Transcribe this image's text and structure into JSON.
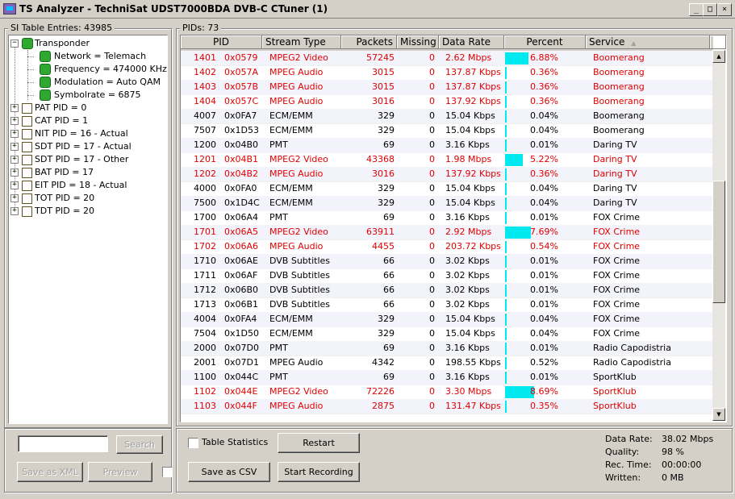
{
  "window": {
    "title": "TS Analyzer - TechniSat UDST7000BDA DVB-C CTuner (1)",
    "buttons": {
      "minimize": "_",
      "maximize": "□",
      "close": "×"
    }
  },
  "si_panel": {
    "label": "SI Table Entries: 43985",
    "tree": [
      {
        "label": "Transponder",
        "icon": "green-dot-icon",
        "level": 0,
        "expander": "−"
      },
      {
        "label": "Network = Telemach",
        "icon": "green-dot-icon",
        "level": 1,
        "expander": ""
      },
      {
        "label": "Frequency = 474000 KHz",
        "icon": "green-dot-icon",
        "level": 1,
        "expander": ""
      },
      {
        "label": "Modulation = Auto QAM",
        "icon": "green-dot-icon",
        "level": 1,
        "expander": ""
      },
      {
        "label": "Symbolrate = 6875",
        "icon": "green-dot-icon",
        "level": 1,
        "expander": ""
      },
      {
        "label": "PAT PID = 0",
        "icon": "table-icon",
        "level": 0,
        "expander": "+"
      },
      {
        "label": "CAT PID = 1",
        "icon": "table-icon",
        "level": 0,
        "expander": "+"
      },
      {
        "label": "NIT PID = 16 - Actual",
        "icon": "table-icon",
        "level": 0,
        "expander": "+"
      },
      {
        "label": "SDT PID = 17 - Actual",
        "icon": "table-icon",
        "level": 0,
        "expander": "+"
      },
      {
        "label": "SDT PID = 17 - Other",
        "icon": "table-icon",
        "level": 0,
        "expander": "+"
      },
      {
        "label": "BAT PID = 17",
        "icon": "table-icon",
        "level": 0,
        "expander": "+"
      },
      {
        "label": "EIT PID = 18 - Actual",
        "icon": "table-icon",
        "level": 0,
        "expander": "+"
      },
      {
        "label": "TOT PID = 20",
        "icon": "table-icon",
        "level": 0,
        "expander": "+"
      },
      {
        "label": "TDT PID = 20",
        "icon": "table-icon",
        "level": 0,
        "expander": "+"
      }
    ],
    "search_input": {
      "value": "",
      "placeholder": ""
    },
    "search_button": "Search",
    "save_xml_button": "Save as XML",
    "preview_button": "Preview"
  },
  "pid_panel": {
    "label": "PIDs: 73",
    "columns": [
      "PID",
      "Stream Type",
      "Packets",
      "Missing",
      "Data Rate",
      "Percent",
      "Service"
    ],
    "sort_indicator": "▲",
    "rows": [
      {
        "pid": "1401",
        "hex": "0x0579",
        "type": "MPEG2 Video",
        "packets": "57245",
        "missing": "0",
        "rate": "2.62 Mbps",
        "percent": "6.88%",
        "pct": 6.88,
        "service": "Boomerang",
        "red": true
      },
      {
        "pid": "1402",
        "hex": "0x057A",
        "type": "MPEG Audio",
        "packets": "3015",
        "missing": "0",
        "rate": "137.87 Kbps",
        "percent": "0.36%",
        "pct": 0.36,
        "service": "Boomerang",
        "red": true
      },
      {
        "pid": "1403",
        "hex": "0x057B",
        "type": "MPEG Audio",
        "packets": "3015",
        "missing": "0",
        "rate": "137.87 Kbps",
        "percent": "0.36%",
        "pct": 0.36,
        "service": "Boomerang",
        "red": true
      },
      {
        "pid": "1404",
        "hex": "0x057C",
        "type": "MPEG Audio",
        "packets": "3016",
        "missing": "0",
        "rate": "137.92 Kbps",
        "percent": "0.36%",
        "pct": 0.36,
        "service": "Boomerang",
        "red": true
      },
      {
        "pid": "4007",
        "hex": "0x0FA7",
        "type": "ECM/EMM",
        "packets": "329",
        "missing": "0",
        "rate": "15.04 Kbps",
        "percent": "0.04%",
        "pct": 0.04,
        "service": "Boomerang",
        "red": false
      },
      {
        "pid": "7507",
        "hex": "0x1D53",
        "type": "ECM/EMM",
        "packets": "329",
        "missing": "0",
        "rate": "15.04 Kbps",
        "percent": "0.04%",
        "pct": 0.04,
        "service": "Boomerang",
        "red": false
      },
      {
        "pid": "1200",
        "hex": "0x04B0",
        "type": "PMT",
        "packets": "69",
        "missing": "0",
        "rate": "3.16 Kbps",
        "percent": "0.01%",
        "pct": 0.01,
        "service": "Daring TV",
        "red": false
      },
      {
        "pid": "1201",
        "hex": "0x04B1",
        "type": "MPEG2 Video",
        "packets": "43368",
        "missing": "0",
        "rate": "1.98 Mbps",
        "percent": "5.22%",
        "pct": 5.22,
        "service": "Daring TV",
        "red": true
      },
      {
        "pid": "1202",
        "hex": "0x04B2",
        "type": "MPEG Audio",
        "packets": "3016",
        "missing": "0",
        "rate": "137.92 Kbps",
        "percent": "0.36%",
        "pct": 0.36,
        "service": "Daring TV",
        "red": true
      },
      {
        "pid": "4000",
        "hex": "0x0FA0",
        "type": "ECM/EMM",
        "packets": "329",
        "missing": "0",
        "rate": "15.04 Kbps",
        "percent": "0.04%",
        "pct": 0.04,
        "service": "Daring TV",
        "red": false
      },
      {
        "pid": "7500",
        "hex": "0x1D4C",
        "type": "ECM/EMM",
        "packets": "329",
        "missing": "0",
        "rate": "15.04 Kbps",
        "percent": "0.04%",
        "pct": 0.04,
        "service": "Daring TV",
        "red": false
      },
      {
        "pid": "1700",
        "hex": "0x06A4",
        "type": "PMT",
        "packets": "69",
        "missing": "0",
        "rate": "3.16 Kbps",
        "percent": "0.01%",
        "pct": 0.01,
        "service": "FOX Crime",
        "red": false
      },
      {
        "pid": "1701",
        "hex": "0x06A5",
        "type": "MPEG2 Video",
        "packets": "63911",
        "missing": "0",
        "rate": "2.92 Mbps",
        "percent": "7.69%",
        "pct": 7.69,
        "service": "FOX Crime",
        "red": true
      },
      {
        "pid": "1702",
        "hex": "0x06A6",
        "type": "MPEG Audio",
        "packets": "4455",
        "missing": "0",
        "rate": "203.72 Kbps",
        "percent": "0.54%",
        "pct": 0.54,
        "service": "FOX Crime",
        "red": true
      },
      {
        "pid": "1710",
        "hex": "0x06AE",
        "type": "DVB Subtitles",
        "packets": "66",
        "missing": "0",
        "rate": "3.02 Kbps",
        "percent": "0.01%",
        "pct": 0.01,
        "service": "FOX Crime",
        "red": false
      },
      {
        "pid": "1711",
        "hex": "0x06AF",
        "type": "DVB Subtitles",
        "packets": "66",
        "missing": "0",
        "rate": "3.02 Kbps",
        "percent": "0.01%",
        "pct": 0.01,
        "service": "FOX Crime",
        "red": false
      },
      {
        "pid": "1712",
        "hex": "0x06B0",
        "type": "DVB Subtitles",
        "packets": "66",
        "missing": "0",
        "rate": "3.02 Kbps",
        "percent": "0.01%",
        "pct": 0.01,
        "service": "FOX Crime",
        "red": false
      },
      {
        "pid": "1713",
        "hex": "0x06B1",
        "type": "DVB Subtitles",
        "packets": "66",
        "missing": "0",
        "rate": "3.02 Kbps",
        "percent": "0.01%",
        "pct": 0.01,
        "service": "FOX Crime",
        "red": false
      },
      {
        "pid": "4004",
        "hex": "0x0FA4",
        "type": "ECM/EMM",
        "packets": "329",
        "missing": "0",
        "rate": "15.04 Kbps",
        "percent": "0.04%",
        "pct": 0.04,
        "service": "FOX Crime",
        "red": false
      },
      {
        "pid": "7504",
        "hex": "0x1D50",
        "type": "ECM/EMM",
        "packets": "329",
        "missing": "0",
        "rate": "15.04 Kbps",
        "percent": "0.04%",
        "pct": 0.04,
        "service": "FOX Crime",
        "red": false
      },
      {
        "pid": "2000",
        "hex": "0x07D0",
        "type": "PMT",
        "packets": "69",
        "missing": "0",
        "rate": "3.16 Kbps",
        "percent": "0.01%",
        "pct": 0.01,
        "service": "Radio Capodistria",
        "red": false
      },
      {
        "pid": "2001",
        "hex": "0x07D1",
        "type": "MPEG Audio",
        "packets": "4342",
        "missing": "0",
        "rate": "198.55 Kbps",
        "percent": "0.52%",
        "pct": 0.52,
        "service": "Radio Capodistria",
        "red": false
      },
      {
        "pid": "1100",
        "hex": "0x044C",
        "type": "PMT",
        "packets": "69",
        "missing": "0",
        "rate": "3.16 Kbps",
        "percent": "0.01%",
        "pct": 0.01,
        "service": "SportKlub",
        "red": false
      },
      {
        "pid": "1102",
        "hex": "0x044E",
        "type": "MPEG2 Video",
        "packets": "72226",
        "missing": "0",
        "rate": "3.30 Mbps",
        "percent": "8.69%",
        "pct": 8.69,
        "service": "SportKlub",
        "red": true
      },
      {
        "pid": "1103",
        "hex": "0x044F",
        "type": "MPEG Audio",
        "packets": "2875",
        "missing": "0",
        "rate": "131.47 Kbps",
        "percent": "0.35%",
        "pct": 0.35,
        "service": "SportKlub",
        "red": true
      }
    ],
    "table_statistics_label": "Table Statistics",
    "table_statistics_checked": false,
    "restart_button": "Restart",
    "save_csv_button": "Save as CSV",
    "start_recording_button": "Start Recording"
  },
  "stats": {
    "data_rate_label": "Data Rate:",
    "data_rate": "38.02 Mbps",
    "quality_label": "Quality:",
    "quality": "98 %",
    "rec_time_label": "Rec. Time:",
    "rec_time": "00:00:00",
    "written_label": "Written:",
    "written": "0 MB"
  },
  "colors": {
    "accent_bar": "#00e8f0",
    "highlight_text": "#e00000",
    "tree_dot": "#2ea82e"
  }
}
